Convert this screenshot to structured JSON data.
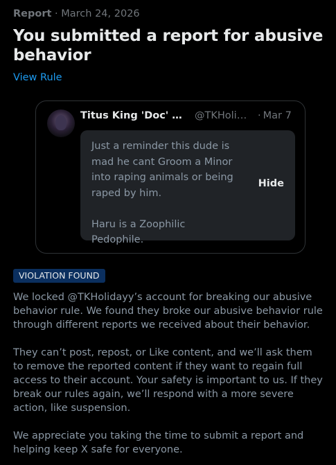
{
  "header": {
    "label": "Report",
    "separator": "·",
    "date": "March 24, 2026",
    "title": "You submitted a report for abusive behavior",
    "view_rule_link": "View Rule"
  },
  "reported_post": {
    "author_name": "Titus King 'Doc' Holi...",
    "author_handle": "@TKHolid...",
    "date_separator": "·",
    "date": "Mar 7",
    "paragraphs": [
      "Just a reminder this dude is mad he cant Groom a Minor into raping animals or being raped by him.",
      "Haru is a Zoophilic Pedophile."
    ],
    "hide_label": "Hide"
  },
  "verdict": {
    "badge": "VIOLATION FOUND",
    "badge_color": "#0b2f5f",
    "paragraphs": [
      "We locked @TKHolidayy’s account for breaking our abusive behavior rule. We found they broke our abusive behavior rule through different reports we received about their behavior.",
      "They can’t post, repost, or Like content, and we’ll ask them to remove the reported content if they want to regain full access to their account. Your safety is important to us. If they break our rules again, we’ll respond with a more severe action, like suspension.",
      "We appreciate you taking the time to submit a report and helping keep X safe for everyone."
    ]
  },
  "colors": {
    "background": "#000000",
    "primary_text": "#e7e9ea",
    "secondary_text": "#71767b",
    "link": "#1d9bf0"
  }
}
